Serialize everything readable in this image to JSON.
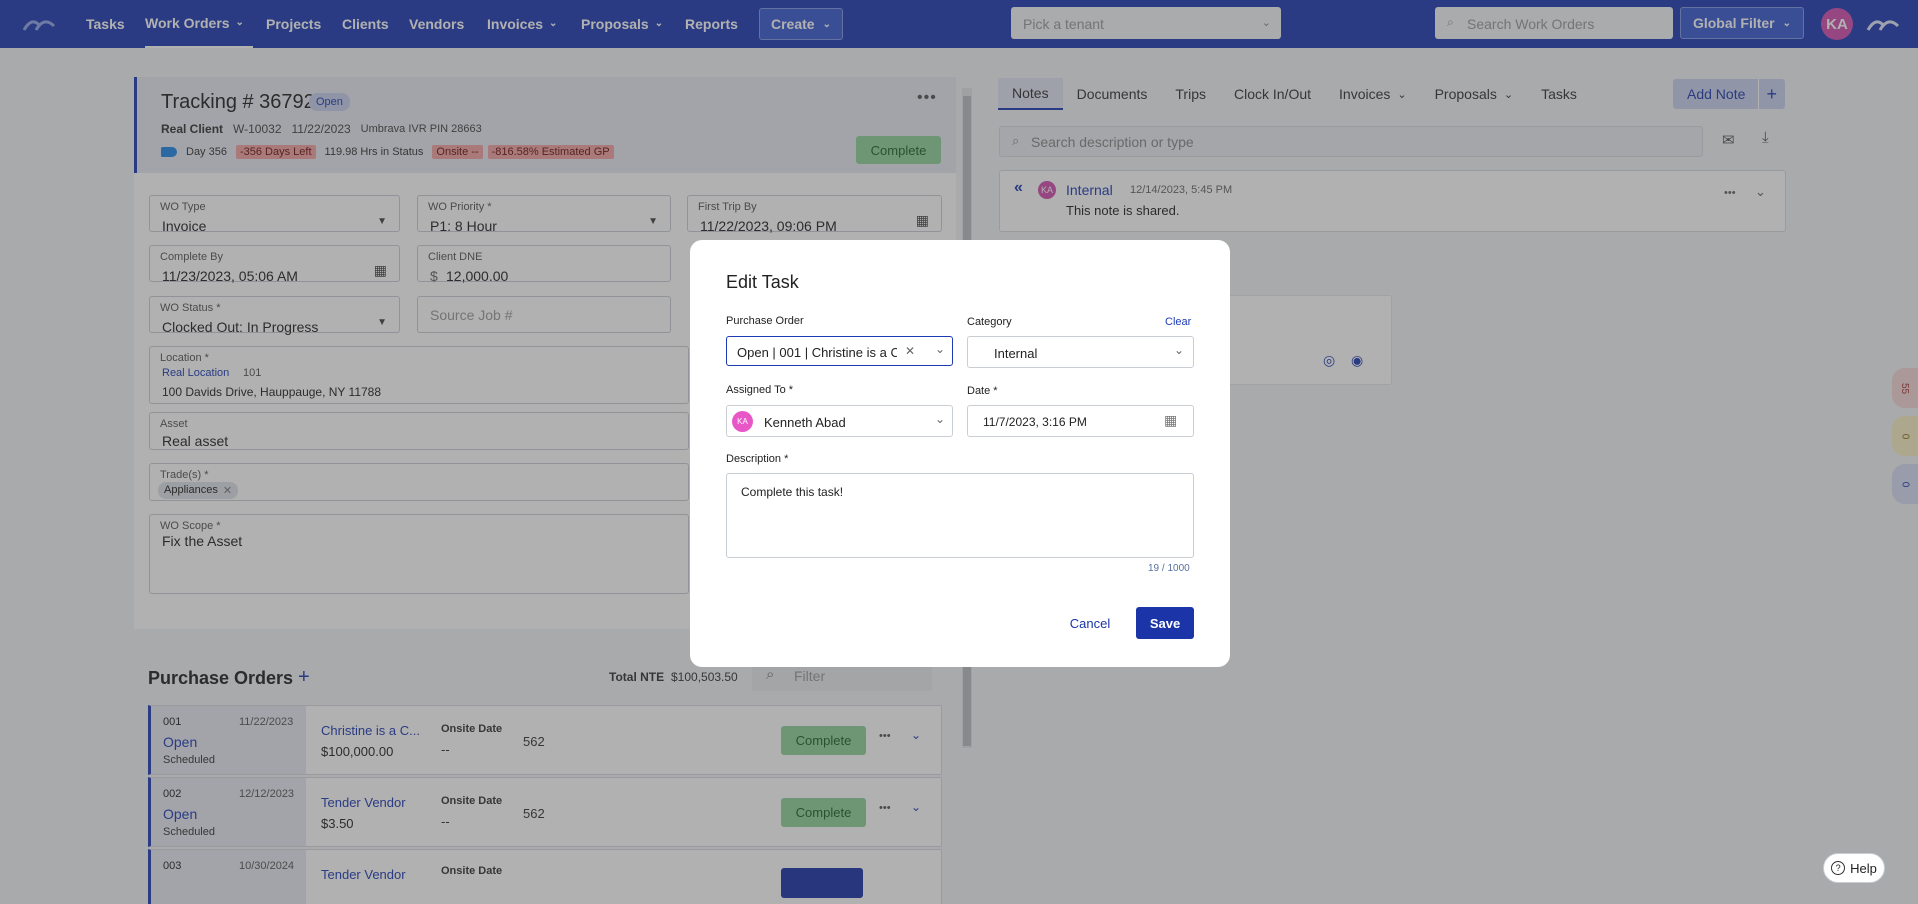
{
  "nav": {
    "items": [
      {
        "label": "Tasks"
      },
      {
        "label": "Work Orders",
        "chev": "⌄"
      },
      {
        "label": "Projects"
      },
      {
        "label": "Clients"
      },
      {
        "label": "Vendors"
      },
      {
        "label": "Invoices",
        "chev": "⌄"
      },
      {
        "label": "Proposals",
        "chev": "⌄"
      },
      {
        "label": "Reports"
      }
    ],
    "create_label": "Create",
    "tenant_placeholder": "Pick a tenant",
    "search_placeholder": "Search Work Orders",
    "global_filter_label": "Global Filter",
    "avatar_initials": "KA"
  },
  "work_order": {
    "tracking": "Tracking # 36792",
    "status": "Open",
    "client": "Real Client",
    "wo_number": "W-10032",
    "date": "11/22/2023",
    "ivr": "Umbrava IVR PIN 28663",
    "day": "Day 356",
    "days_left": "-356 Days Left",
    "hrs_status": "119.98 Hrs in Status",
    "onsite": "Onsite --",
    "gp": "-816.58% Estimated GP",
    "complete_label": "Complete",
    "fields": {
      "wo_type_label": "WO Type",
      "wo_type": "Invoice",
      "priority_label": "WO Priority *",
      "priority": "P1: 8 Hour",
      "first_trip_label": "First Trip By",
      "first_trip": "11/22/2023, 09:06 PM",
      "complete_by_label": "Complete By",
      "complete_by": "11/23/2023, 05:06 AM",
      "client_dne_label": "Client DNE",
      "client_dne_currency": "$",
      "client_dne": "12,000.00",
      "wo_status_label": "WO Status *",
      "wo_status": "Clocked Out: In Progress",
      "source_job_placeholder": "Source Job #",
      "location_label": "Location *",
      "location_name": "Real Location",
      "location_num": "101",
      "location_address": "100 Davids Drive, Hauppauge, NY 11788",
      "asset_label": "Asset",
      "asset": "Real asset",
      "trades_label": "Trade(s) *",
      "trade_chip": "Appliances",
      "scope_label": "WO Scope *",
      "scope": "Fix the Asset"
    }
  },
  "purchase_orders": {
    "title": "Purchase Orders",
    "total_label": "Total NTE",
    "total": "$100,503.50",
    "filter_placeholder": "Filter",
    "rows": [
      {
        "num": "001",
        "date": "11/22/2023",
        "status": "Open",
        "sub": "Scheduled",
        "vendor": "Christine is a C...",
        "amount": "$100,000.00",
        "onsite_label": "Onsite Date",
        "onsite": "--",
        "code": "562",
        "action": "Complete"
      },
      {
        "num": "002",
        "date": "12/12/2023",
        "status": "Open",
        "sub": "Scheduled",
        "vendor": "Tender Vendor",
        "amount": "$3.50",
        "onsite_label": "Onsite Date",
        "onsite": "--",
        "code": "562",
        "action": "Complete"
      },
      {
        "num": "003",
        "date": "10/30/2024",
        "vendor": "Tender Vendor",
        "onsite_label": "Onsite Date"
      }
    ]
  },
  "right": {
    "tabs": [
      {
        "label": "Notes"
      },
      {
        "label": "Documents"
      },
      {
        "label": "Trips"
      },
      {
        "label": "Clock In/Out"
      },
      {
        "label": "Invoices",
        "chev": "⌄"
      },
      {
        "label": "Proposals",
        "chev": "⌄"
      },
      {
        "label": "Tasks"
      }
    ],
    "add_note_label": "Add Note",
    "search_placeholder": "Search description or type",
    "note": {
      "avatar": "KA",
      "type": "Internal",
      "time": "12/14/2023, 5:45 PM",
      "text": "This note is shared."
    }
  },
  "side_pills": [
    "55",
    "0",
    "0"
  ],
  "modal": {
    "title": "Edit Task",
    "po_label": "Purchase Order",
    "po_value": "Open | 001 | Christine is a C",
    "category_label": "Category",
    "clear_label": "Clear",
    "category_value": "Internal",
    "assigned_label": "Assigned To *",
    "assigned_avatar": "KA",
    "assigned_value": "Kenneth Abad",
    "date_label": "Date *",
    "date_value": "11/7/2023, 3:16 PM",
    "description_label": "Description *",
    "description_value": "Complete this task!",
    "char_count": "19 / 1000",
    "cancel_label": "Cancel",
    "save_label": "Save"
  },
  "help_label": "Help"
}
